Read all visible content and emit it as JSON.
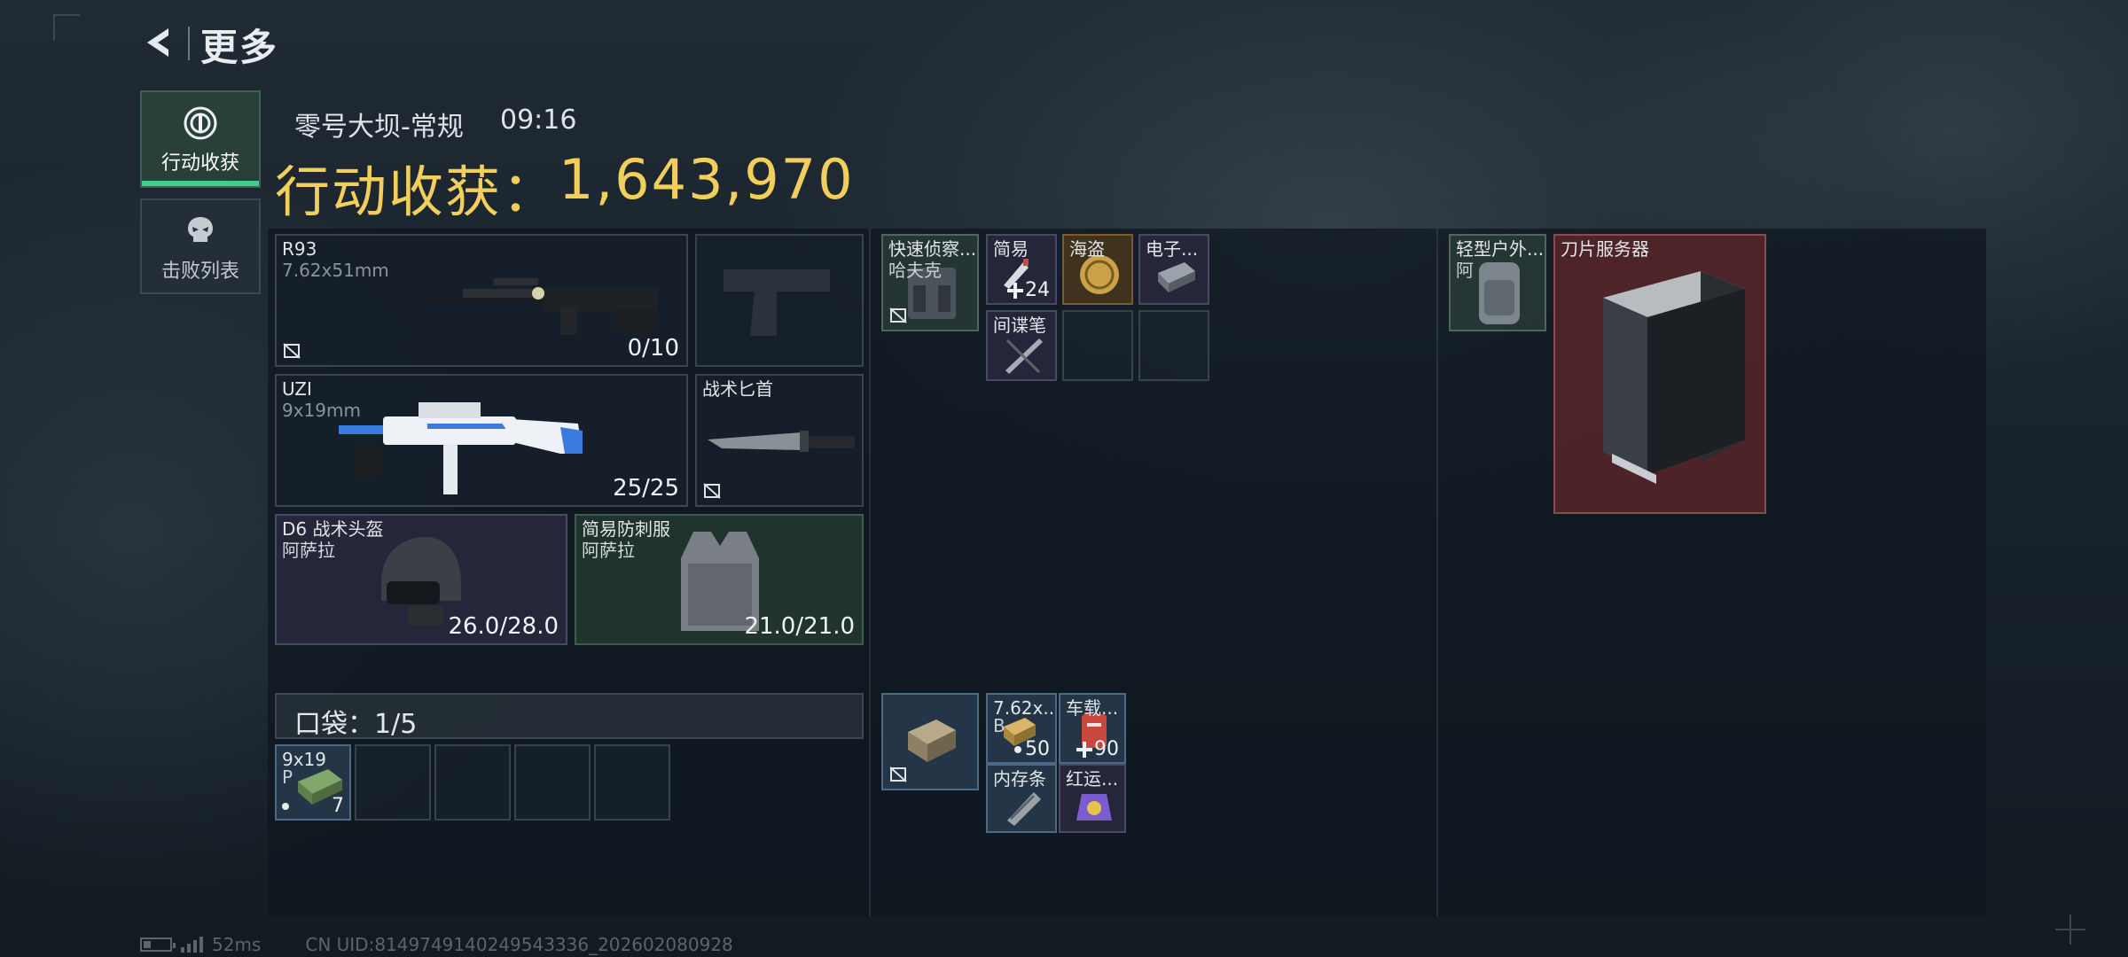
{
  "header": {
    "title": "更多"
  },
  "tabs": [
    {
      "label": "行动收获",
      "active": true
    },
    {
      "label": "击败列表",
      "active": false
    }
  ],
  "match": {
    "map": "零号大坝-常规",
    "time": "09:16",
    "loot_label": "行动收获：",
    "loot_value": "1,643,970"
  },
  "equipment": {
    "primary1": {
      "name": "R93",
      "sub": "7.62x51mm",
      "ammo": "0/10"
    },
    "primary2": {
      "name": "UZI",
      "sub": "9x19mm",
      "ammo": "25/25"
    },
    "melee": {
      "name": "战术匕首"
    },
    "helmet": {
      "name": "D6 战术头盔",
      "sub": "阿萨拉",
      "durability": "26.0/28.0"
    },
    "armor": {
      "name": "简易防刺服",
      "sub": "阿萨拉",
      "durability": "21.0/21.0"
    }
  },
  "pocket": {
    "label": "口袋：",
    "count": "1/5",
    "items": [
      {
        "name": "9x19",
        "sub": "P",
        "qty": "7"
      }
    ]
  },
  "rig": {
    "name": "快速侦察...",
    "sub": "哈夫克",
    "items": [
      {
        "name": "简易",
        "qty": "24"
      },
      {
        "name": "海盗"
      },
      {
        "name": "电子..."
      },
      {
        "name": "间谍笔"
      }
    ]
  },
  "pouch": {
    "items": [
      {
        "name": "7.62x...",
        "sub": "B",
        "qty": "50"
      },
      {
        "name": "车载...",
        "qty": "90"
      },
      {
        "name": "内存条"
      },
      {
        "name": "红运..."
      }
    ]
  },
  "backpack": {
    "name": "轻型户外...",
    "sub": "阿",
    "items": [
      {
        "name": "刀片服务器"
      }
    ]
  },
  "footer": {
    "ping": "52ms",
    "uid": "CN UID:8149749140249543336_202602080928"
  }
}
